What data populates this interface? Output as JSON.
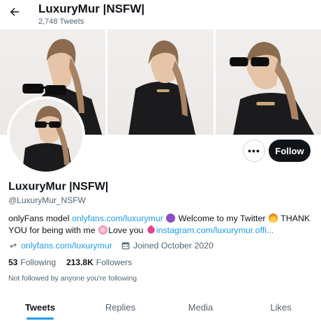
{
  "header": {
    "title": "LuxuryMur |NSFW|",
    "tweet_count": "2,748 Tweets"
  },
  "profile": {
    "name": "LuxuryMur |NSFW|",
    "handle": "@LuxuryMur_NSFW",
    "bio": {
      "part1": "onlyFans model ",
      "link1": "onlyfans.com/luxurymur",
      "part2": " Welcome to my Twitter ",
      "part3": " THANK YOU for being with me ",
      "part4": "Love you ",
      "link2": "instagram.com/luxurymur.offi..."
    },
    "website": "onlyfans.com/luxurymur",
    "joined": "Joined October 2020",
    "following_count": "53",
    "following_label": "Following",
    "followers_count": "213.8K",
    "followers_label": "Followers",
    "not_followed": "Not followed by anyone you're following"
  },
  "actions": {
    "more_label": "•••",
    "follow_label": "Follow"
  },
  "tabs": [
    {
      "label": "Tweets",
      "active": true
    },
    {
      "label": "Replies",
      "active": false
    },
    {
      "label": "Media",
      "active": false
    },
    {
      "label": "Likes",
      "active": false
    }
  ],
  "colors": {
    "accent": "#1d9bf0",
    "text": "#0f1419",
    "secondary": "#536471",
    "follow_button": "#0f1419"
  },
  "icons": [
    "back-arrow-icon",
    "link-icon",
    "calendar-icon",
    "more-icon"
  ]
}
